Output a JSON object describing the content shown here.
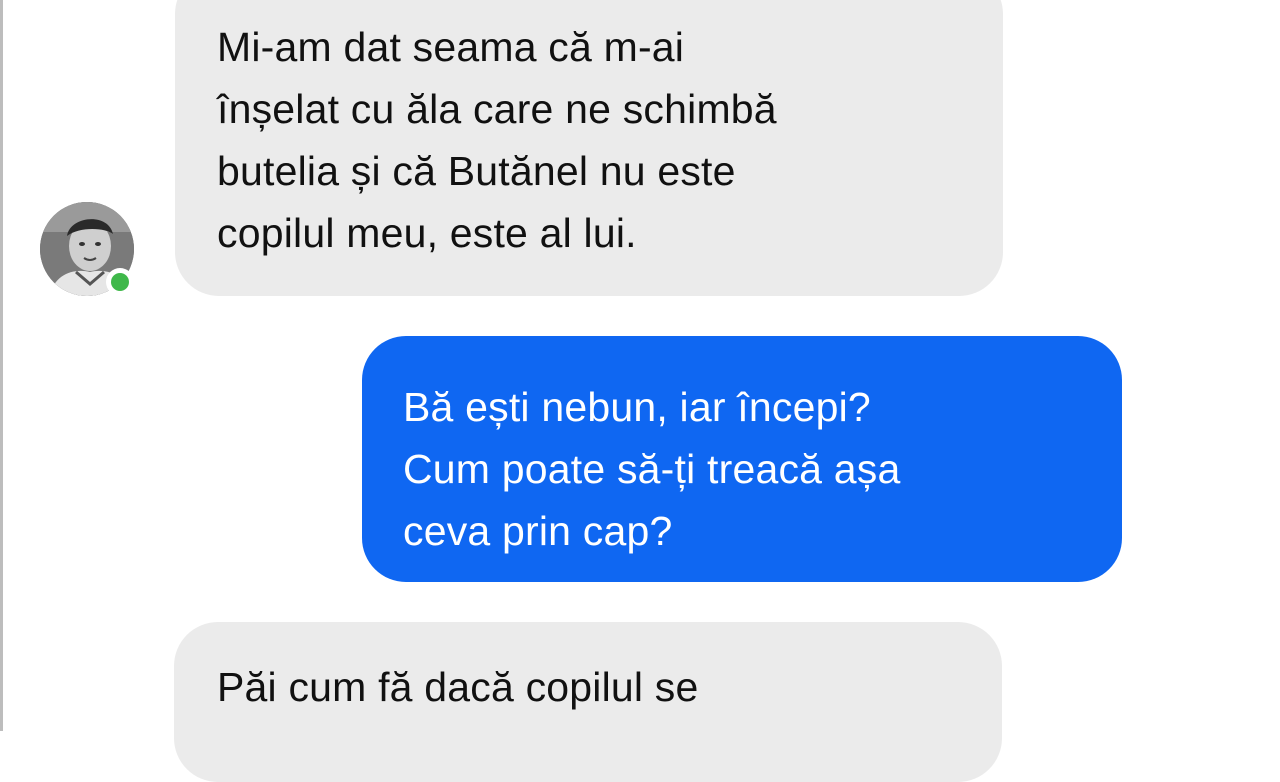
{
  "conversation": {
    "messages": [
      {
        "direction": "incoming",
        "lines": [
          "Mi-am dat seama că m-ai",
          "înșelat cu ăla care ne schimbă",
          "butelia și că Butănel nu este",
          "copilul meu, este al lui."
        ]
      },
      {
        "direction": "outgoing",
        "lines": [
          "Bă ești nebun, iar începi?",
          "Cum poate să-ți treacă așa",
          "ceva prin cap?"
        ]
      },
      {
        "direction": "incoming",
        "lines": [
          "Păi cum fă dacă copilul se"
        ]
      }
    ],
    "contact": {
      "avatar_icon": "contact-avatar",
      "presence": "online"
    }
  },
  "colors": {
    "incoming_bubble": "#ebebeb",
    "outgoing_bubble": "#0f67f2",
    "incoming_text": "#111111",
    "outgoing_text": "#ffffff",
    "presence_online": "#3fb84a"
  }
}
